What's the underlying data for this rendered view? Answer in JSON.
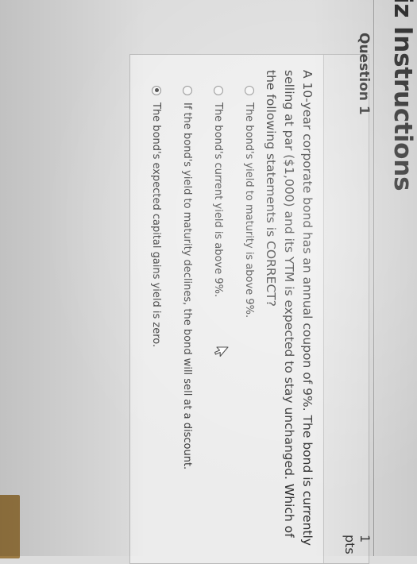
{
  "page": {
    "title": "iz Instructions"
  },
  "question": {
    "label": "Question 1",
    "points": "1 pts",
    "text": "A 10-year corporate bond has an annual coupon of 9%. The bond is currently selling at par ($1,000) and its YTM is expected to stay unchanged. Which of the following statements is CORRECT?",
    "answers": [
      {
        "label": "The bond's yield to maturity is above 9%.",
        "selected": false
      },
      {
        "label": "The bond's current yield is above 9%.",
        "selected": false
      },
      {
        "label": "If the bond's yield to maturity declines, the bond will sell at a discount.",
        "selected": false
      },
      {
        "label": "The bond's expected capital gains yield is zero.",
        "selected": true
      }
    ]
  },
  "colors": {
    "accent_button": "#9b7a43",
    "background": "#dcdcdc"
  }
}
